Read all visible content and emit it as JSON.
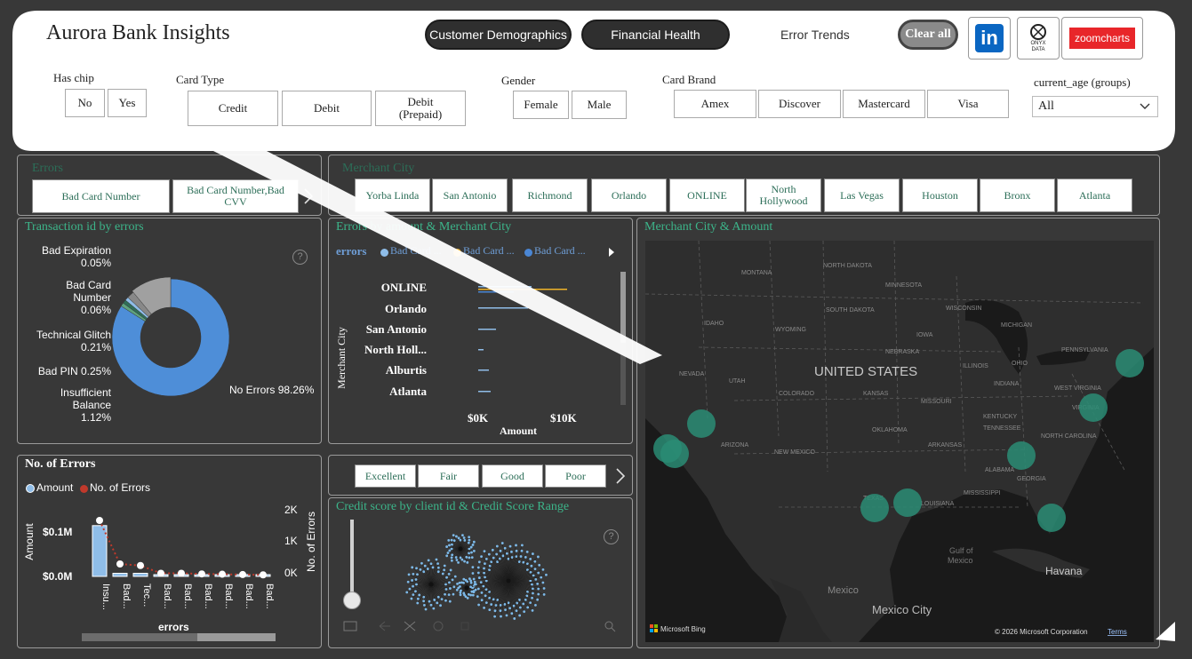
{
  "header": {
    "title": "Aurora Bank Insights",
    "nav": [
      "Customer Demographics",
      "Financial Health",
      "Error Trends"
    ],
    "clear_all": "Clear all",
    "logos": {
      "onyx_line1": "ONYX",
      "onyx_line2": "DATA",
      "zoomcharts": "zoomcharts"
    }
  },
  "filters": {
    "has_chip": {
      "label": "Has chip",
      "options": [
        "No",
        "Yes"
      ]
    },
    "card_type": {
      "label": "Card Type",
      "options": [
        "Credit",
        "Debit",
        "Debit (Prepaid)"
      ]
    },
    "gender": {
      "label": "Gender",
      "options": [
        "Female",
        "Male"
      ]
    },
    "card_brand": {
      "label": "Card Brand",
      "options": [
        "Amex",
        "Discover",
        "Mastercard",
        "Visa"
      ]
    },
    "age": {
      "label": "current_age (groups)",
      "value": "All"
    }
  },
  "errors_slicer": {
    "title": "Errors",
    "options": [
      "Bad Card Number",
      "Bad Card Number,Bad CVV"
    ]
  },
  "merchant_slicer": {
    "title": "Merchant City",
    "options": [
      "Yorba Linda",
      "San Antonio",
      "Richmond",
      "Orlando",
      "ONLINE",
      "North Hollywood",
      "Las Vegas",
      "Houston",
      "Bronx",
      "Atlanta"
    ]
  },
  "donut": {
    "title": "Transaction id by errors",
    "labels": [
      {
        "name": "Bad Expiration",
        "pct": "0.05%"
      },
      {
        "name": "Bad Card Number",
        "pct": "0.06%"
      },
      {
        "name": "Technical Glitch",
        "pct": "0.21%"
      },
      {
        "name": "Bad PIN",
        "pct": "0.25%"
      },
      {
        "name": "Insufficient Balance",
        "pct": "1.12%"
      },
      {
        "name": "No Errors",
        "pct": "98.26%"
      }
    ],
    "help": "?"
  },
  "bar_panel": {
    "title": "Errors by amount & Merchant City",
    "legend_title": "errors",
    "legend": [
      "Bad Card ...",
      "Bad Card ...",
      "Bad Card ..."
    ],
    "legend_colors": [
      "#8fbde8",
      "#f0b429",
      "#4a86d4"
    ],
    "ylabel": "Merchant City",
    "cities": [
      "ONLINE",
      "Orlando",
      "San Antonio",
      "North Holl...",
      "Alburtis",
      "Atlanta"
    ],
    "ticks": [
      "$0K",
      "$10K"
    ],
    "xlabel": "Amount"
  },
  "map": {
    "title": "Merchant City & Amount",
    "country": "UNITED STATES",
    "states": [
      "MONTANA",
      "NORTH DAKOTA",
      "MINNESOTA",
      "SOUTH DAKOTA",
      "WISCONSIN",
      "IDAHO",
      "WYOMING",
      "IOWA",
      "MICHIGAN",
      "NEBRASKA",
      "NEVADA",
      "UTAH",
      "COLORADO",
      "KANSAS",
      "MISSOURI",
      "ILLINOIS",
      "INDIANA",
      "OHIO",
      "PENNSYLVANIA",
      "WEST VIRGINIA",
      "VIRGINIA",
      "KENTUCKY",
      "TENNESSEE",
      "OKLAHOMA",
      "ARKANSAS",
      "ARIZONA",
      "NEW MEXICO",
      "TEXAS",
      "ALABAMA",
      "GEORGIA",
      "LOUISIANA",
      "MISSISSIPPI",
      "NORTH CAROLINA"
    ],
    "labels": {
      "gulf": "Gulf of",
      "gulf2": "Mexico",
      "mexico": "Mexico",
      "havana": "Havana",
      "mexcity": "Mexico City"
    },
    "credit": "Microsoft Bing",
    "copyright": "© 2026 Microsoft Corporation",
    "terms": "Terms"
  },
  "errors_panel": {
    "title": "No. of Errors",
    "legend": [
      "Amount",
      "No. of Errors"
    ],
    "legend_colors": [
      "#8fbde8",
      "#c0392b"
    ],
    "yleft": [
      "$0.1M",
      "$0.0M"
    ],
    "yleft_label": "Amount",
    "yright": [
      "2K",
      "1K",
      "0K"
    ],
    "yright_label": "No. of Errors",
    "cats": [
      "Insu...",
      "Bad...",
      "Tec...",
      "Bad...",
      "Bad...",
      "Bad...",
      "Bad...",
      "Bad...",
      "Bad..."
    ],
    "xlabel": "errors"
  },
  "credit_slicer": {
    "options": [
      "Excellent",
      "Fair",
      "Good",
      "Poor"
    ]
  },
  "credit_panel": {
    "title": "Credit score by client id & Credit Score Range",
    "help": "?"
  }
}
